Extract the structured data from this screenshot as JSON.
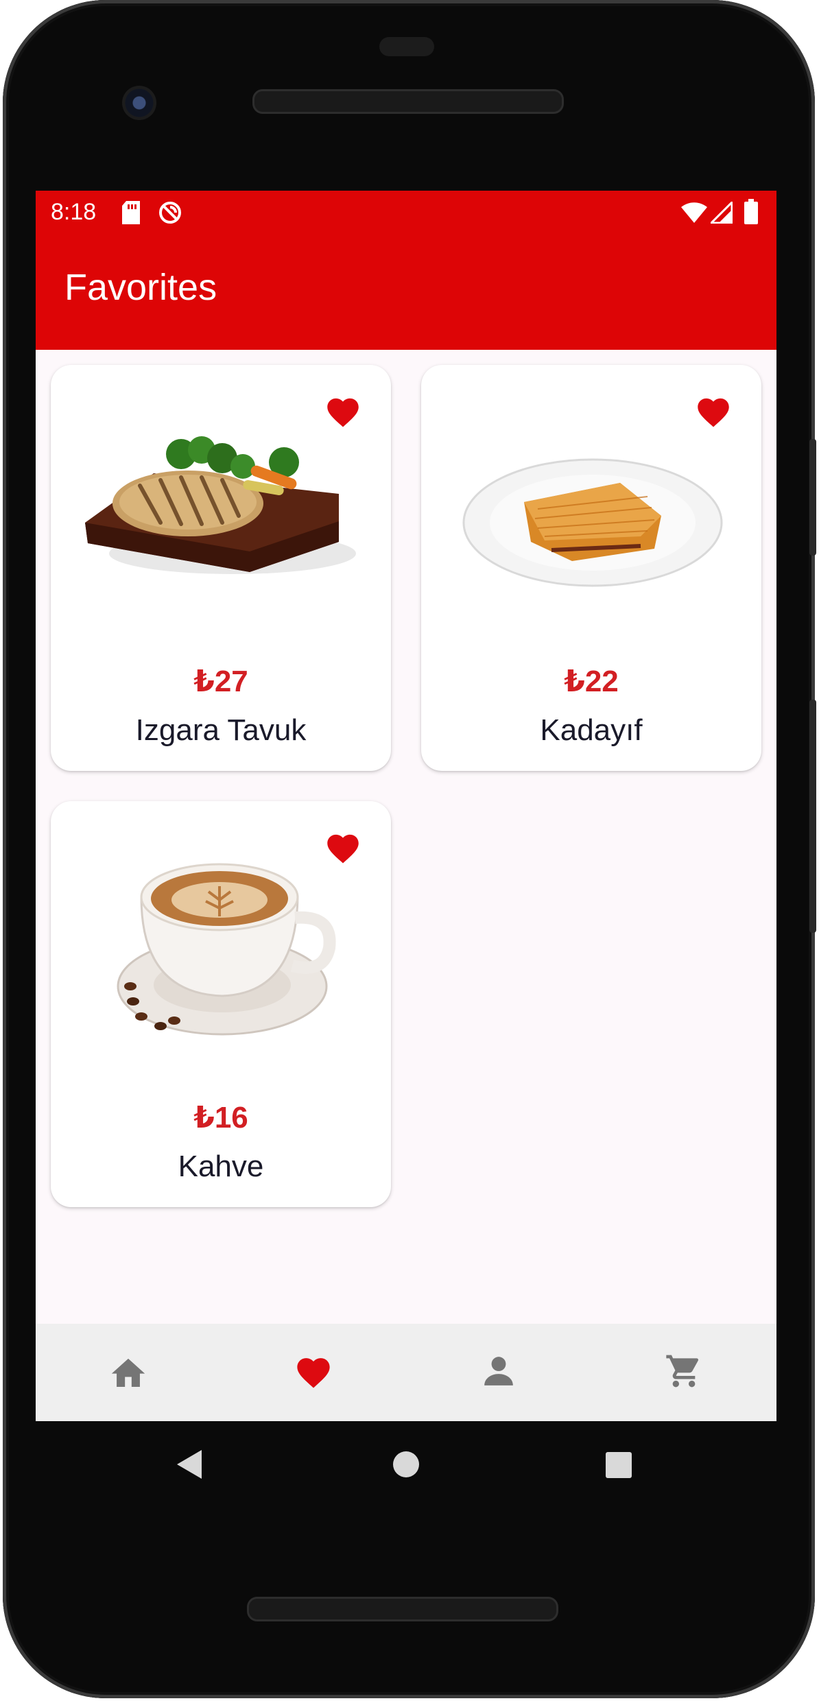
{
  "status_bar": {
    "time": "8:18",
    "left_icons": [
      "sd-card-icon",
      "no-sync-icon"
    ],
    "right_icons": [
      "wifi-icon",
      "signal-icon",
      "battery-icon"
    ]
  },
  "app_bar": {
    "title": "Favorites"
  },
  "colors": {
    "primary": "#dd0506",
    "price": "#d21f23",
    "heart": "#dd0a10",
    "nav_inactive": "#757575",
    "screen_bg": "#fdf8fb",
    "nav_bg": "#efefef"
  },
  "favorites": [
    {
      "price": "₺27",
      "name": "Izgara Tavuk",
      "image": "grilled-chicken-image"
    },
    {
      "price": "₺22",
      "name": "Kadayıf",
      "image": "kadayif-dessert-image"
    },
    {
      "price": "₺16",
      "name": "Kahve",
      "image": "coffee-cup-image"
    }
  ],
  "bottom_nav": {
    "items": [
      {
        "icon": "home-icon",
        "selected": false
      },
      {
        "icon": "heart-icon",
        "selected": true
      },
      {
        "icon": "person-icon",
        "selected": false
      },
      {
        "icon": "cart-icon",
        "selected": false
      }
    ]
  },
  "system_nav": [
    "back-icon",
    "home-circle-icon",
    "recents-icon"
  ]
}
